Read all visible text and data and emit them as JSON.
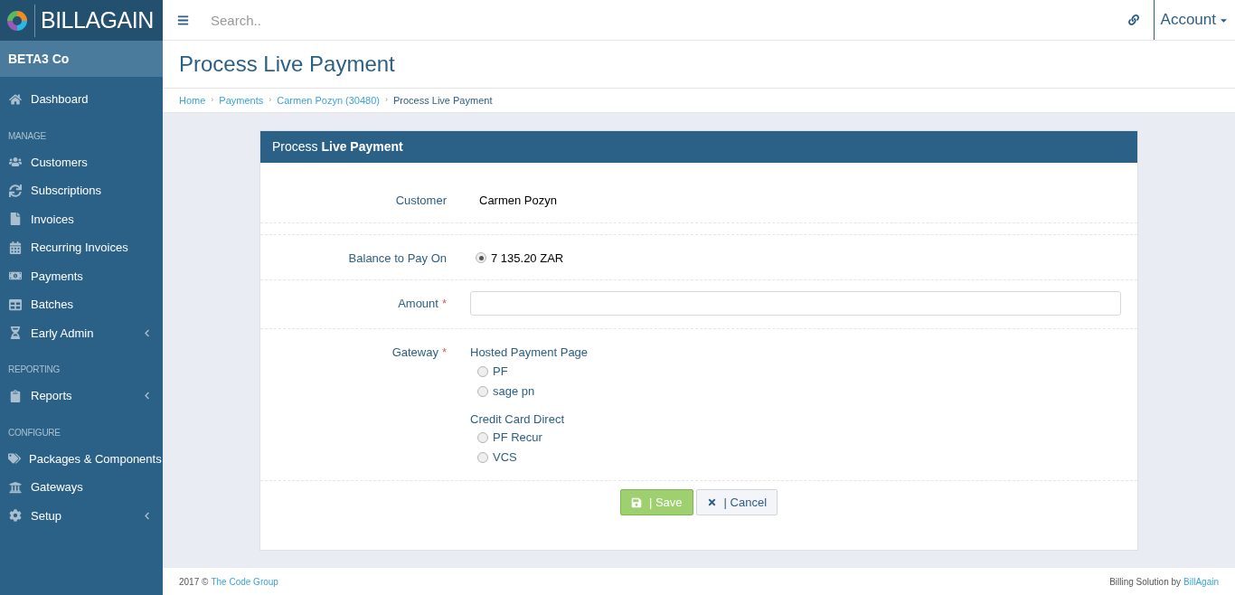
{
  "brand": {
    "logo_text": "**BILL**AGAIN"
  },
  "topbar": {
    "search": {
      "placeholder": "Search.."
    },
    "account": "Account"
  },
  "sidebar": {
    "company": "BETA3 Co",
    "sections": [
      {
        "items": [
          {
            "label": "Dashboard",
            "has_submenu": false
          }
        ]
      },
      {
        "heading": "MANAGE",
        "items": [
          {
            "label": "Customers",
            "has_submenu": false
          },
          {
            "label": "Subscriptions",
            "has_submenu": false
          },
          {
            "label": "Invoices",
            "has_submenu": false
          },
          {
            "label": "Recurring Invoices",
            "has_submenu": false
          },
          {
            "label": "Payments",
            "has_submenu": false
          },
          {
            "label": "Batches",
            "has_submenu": false
          },
          {
            "label": "Early Admin",
            "has_submenu": true
          }
        ]
      },
      {
        "heading": "REPORTING",
        "items": [
          {
            "label": "Reports",
            "has_submenu": true
          }
        ]
      },
      {
        "heading": "CONFIGURE",
        "items": [
          {
            "label": "Packages & Components",
            "has_submenu": false
          },
          {
            "label": "Gateways",
            "has_submenu": false
          },
          {
            "label": "Setup",
            "has_submenu": true
          }
        ]
      }
    ]
  },
  "page": {
    "title": "Process Live Payment",
    "breadcrumb_separator": "›",
    "breadcrumb": [
      "Home",
      "Payments",
      "Carmen Pozyn (30480)",
      "Process Live Payment"
    ]
  },
  "panel": {
    "title": "Process **Live Payment**",
    "customer": {
      "label": "Customer",
      "value": "Carmen Pozyn"
    },
    "balance": {
      "label": "Balance to Pay On",
      "options": [
        {
          "label": "7 135.20 ZAR",
          "selected": true
        }
      ]
    },
    "amount": {
      "label": "Amount",
      "required_mark": "*"
    },
    "gateway": {
      "label": "Gateway",
      "required_mark": "*",
      "groups": [
        {
          "heading": "Hosted Payment Page",
          "options": [
            {
              "label": "PF",
              "selected": false
            },
            {
              "label": "sage pn",
              "selected": false
            }
          ]
        },
        {
          "heading": "Credit Card Direct",
          "options": [
            {
              "label": "PF Recur",
              "selected": false
            },
            {
              "label": "VCS",
              "selected": false
            }
          ]
        }
      ]
    },
    "buttons": [
      {
        "label": "| Save",
        "kind": "save"
      },
      {
        "label": "| Cancel",
        "kind": "cancel"
      }
    ]
  },
  "footer": {
    "copyright": "2017 ©",
    "company_link": "The Code Group",
    "credit": "Billing Solution by",
    "credit_link": "BillAgain"
  }
}
